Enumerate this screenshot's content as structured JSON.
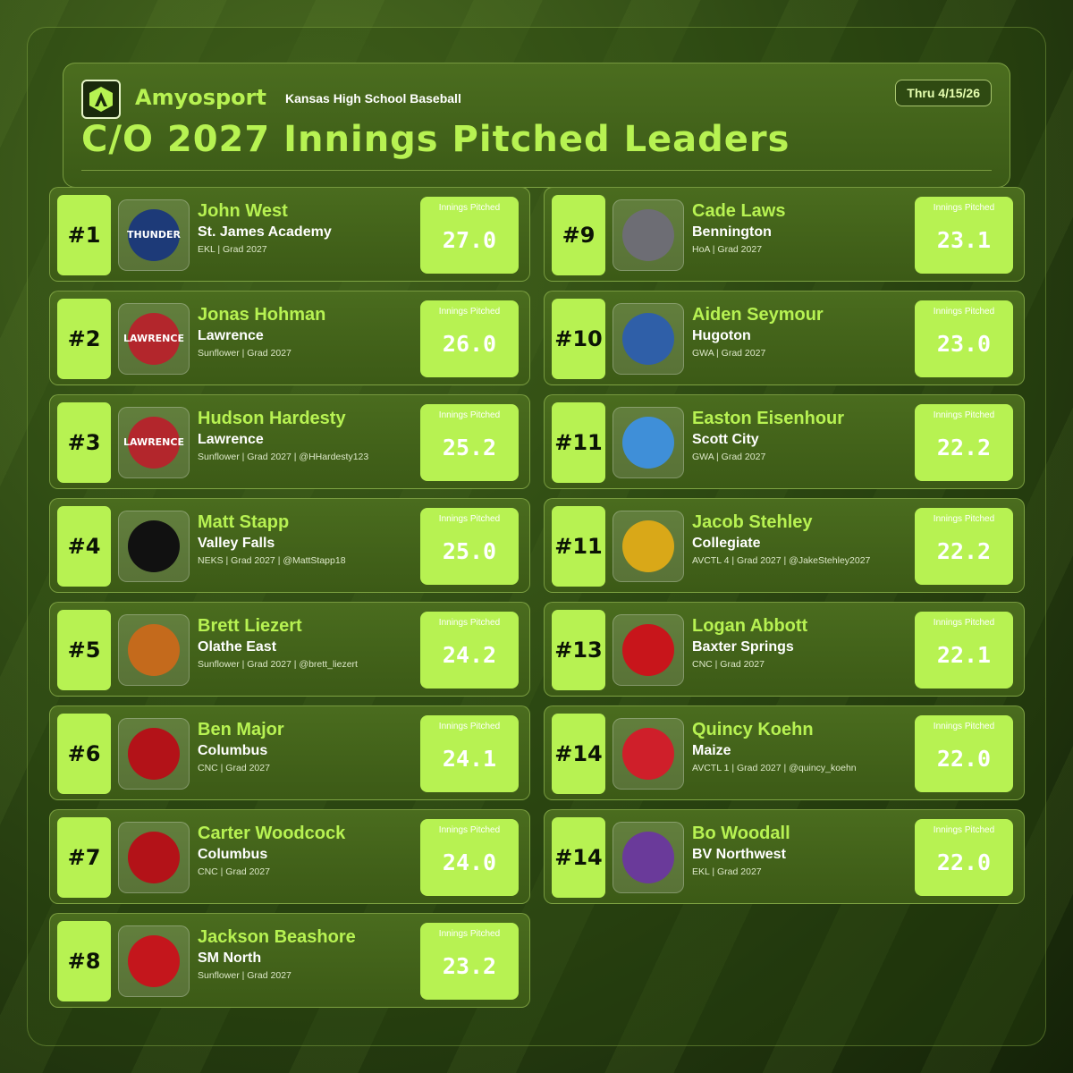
{
  "header": {
    "brand": "Amyosport",
    "logo_text": "AMYOSPORT",
    "subtitle": "Kansas High School Baseball",
    "date": "Thru 4/15/26",
    "title": "C/O 2027 Innings Pitched Leaders"
  },
  "stat_label": "Innings Pitched",
  "colors": {
    "accent": "#b7f252",
    "card": "#44641b",
    "rank_text": "#0c1405"
  },
  "leaders": [
    {
      "rank": "#1",
      "name": "John West",
      "school": "St. James Academy",
      "meta": "EKL | Grad 2027",
      "ip": "27.0",
      "logo_icon": "thunder-logo-icon",
      "logo_text": "THUNDER"
    },
    {
      "rank": "#2",
      "name": "Jonas Hohman",
      "school": "Lawrence",
      "meta": "Sunflower | Grad 2027",
      "ip": "26.0",
      "logo_icon": "lawrence-lion-logo-icon",
      "logo_text": "LAWRENCE"
    },
    {
      "rank": "#3",
      "name": "Hudson Hardesty",
      "school": "Lawrence",
      "meta": "Sunflower | Grad 2027 | @HHardesty123",
      "ip": "25.2",
      "logo_icon": "lawrence-lion-logo-icon",
      "logo_text": "LAWRENCE"
    },
    {
      "rank": "#4",
      "name": "Matt Stapp",
      "school": "Valley Falls",
      "meta": "NEKS | Grad 2027 | @MattStapp18",
      "ip": "25.0",
      "logo_icon": "dragon-logo-icon",
      "logo_text": ""
    },
    {
      "rank": "#5",
      "name": "Brett Liezert",
      "school": "Olathe East",
      "meta": "Sunflower | Grad 2027 | @brett_liezert",
      "ip": "24.2",
      "logo_icon": "hawk-logo-icon",
      "logo_text": ""
    },
    {
      "rank": "#6",
      "name": "Ben Major",
      "school": "Columbus",
      "meta": "CNC | Grad 2027",
      "ip": "24.1",
      "logo_icon": "titan-helmet-logo-icon",
      "logo_text": ""
    },
    {
      "rank": "#7",
      "name": "Carter Woodcock",
      "school": "Columbus",
      "meta": "CNC | Grad 2027",
      "ip": "24.0",
      "logo_icon": "titan-helmet-logo-icon",
      "logo_text": ""
    },
    {
      "rank": "#8",
      "name": "Jackson Beashore",
      "school": "SM North",
      "meta": "Sunflower | Grad 2027",
      "ip": "23.2",
      "logo_icon": "bison-logo-icon",
      "logo_text": ""
    },
    {
      "rank": "#9",
      "name": "Cade Laws",
      "school": "Bennington",
      "meta": "HoA | Grad 2027",
      "ip": "23.1",
      "logo_icon": "bulldog-logo-icon",
      "logo_text": ""
    },
    {
      "rank": "#10",
      "name": "Aiden Seymour",
      "school": "Hugoton",
      "meta": "GWA | Grad 2027",
      "ip": "23.0",
      "logo_icon": "eagle-logo-icon",
      "logo_text": ""
    },
    {
      "rank": "#11",
      "name": "Easton Eisenhour",
      "school": "Scott City",
      "meta": "GWA | Grad 2027",
      "ip": "22.2",
      "logo_icon": "beaver-logo-icon",
      "logo_text": ""
    },
    {
      "rank": "#11",
      "name": "Jacob Stehley",
      "school": "Collegiate",
      "meta": "AVCTL 4 | Grad 2027 | @JakeStehley2027",
      "ip": "22.2",
      "logo_icon": "spartan-helmet-logo-icon",
      "logo_text": ""
    },
    {
      "rank": "#13",
      "name": "Logan Abbott",
      "school": "Baxter Springs",
      "meta": "CNC | Grad 2027",
      "ip": "22.1",
      "logo_icon": "lion-logo-icon",
      "logo_text": ""
    },
    {
      "rank": "#14",
      "name": "Quincy Koehn",
      "school": "Maize",
      "meta": "AVCTL 1 | Grad 2027 | @quincy_koehn",
      "ip": "22.0",
      "logo_icon": "eagle-head-logo-icon",
      "logo_text": ""
    },
    {
      "rank": "#14",
      "name": "Bo Woodall",
      "school": "BV Northwest",
      "meta": "EKL | Grad 2027",
      "ip": "22.0",
      "logo_icon": "husky-logo-icon",
      "logo_text": ""
    }
  ]
}
